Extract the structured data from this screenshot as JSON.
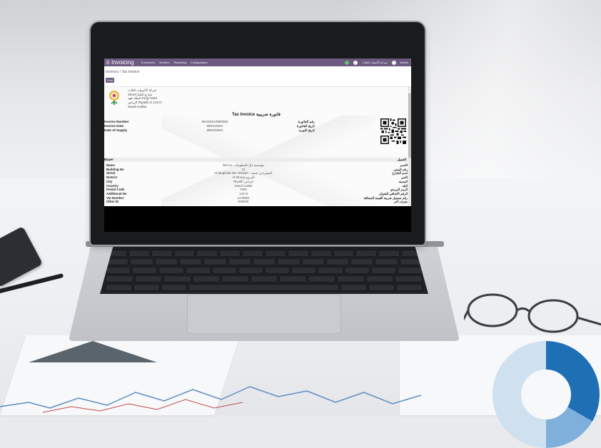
{
  "app": {
    "title": "Invoicing",
    "nav": [
      "Customers",
      "Vendors",
      "Reporting",
      "Configuration"
    ],
    "company_switch": "شركة الأصوات الثلاث",
    "user": "Admin"
  },
  "breadcrumb": {
    "parent": "Invoices",
    "separator": "/",
    "current": "Tax Invoice"
  },
  "toolbar": {
    "print_label": "Print"
  },
  "company": {
    "lines": [
      "شركة الأصوات الثلاث",
      "Street شارع العليا",
      "الملك فهد King Fahd",
      "الرياض Riyadh Al 12271",
      "Saudi Arabia"
    ]
  },
  "invoice": {
    "title_ar": "فاتورة ضريبية",
    "title_en": "Tax Invoice",
    "labels": [
      "Invoice Number",
      "Invoice Date",
      "Date of Supply"
    ],
    "values": [
      "INV/2021/09/0002",
      "09/21/2021",
      "09/22/2021"
    ],
    "labels_ar": [
      "رقم الفاتورة",
      "تاريخ الفاتورة",
      "تاريخ التوريد"
    ]
  },
  "buyer": {
    "heading": "Buyer",
    "heading_ar": "العميل",
    "labels": [
      "Name",
      "Building No",
      "Street",
      "District",
      "City",
      "Country",
      "Postal Code",
      "Additional No",
      "Vat Number",
      "Other ID"
    ],
    "values": [
      "Dal Co. مؤسسة دال للمعلومات",
      "15",
      "Al Mughirah Bin Shubah - المغيرة بن شعبة",
      "Al Mroog المروج",
      "Riyadh الرياض",
      "Saudi Arabia",
      "7905",
      "12274",
      "1478952",
      "000000"
    ],
    "labels_ar": [
      "الاسم",
      "رقم المبنى",
      "اسم الشارع",
      "الحي",
      "المدينة",
      "البلد",
      "الرمز البريدي",
      "الرقم الاضافي للعنوان",
      "رقم تسجيل ضريبة القيمة المضافة",
      "معرف آخر"
    ]
  },
  "colors": {
    "odoo_purple": "#6d5a80",
    "donut_dark": "#1f6fb5",
    "donut_light": "#7fb0dc"
  },
  "icons": {
    "menu": "menu-icon",
    "qr": "qr-code-icon",
    "logo": "company-logo-icon"
  }
}
